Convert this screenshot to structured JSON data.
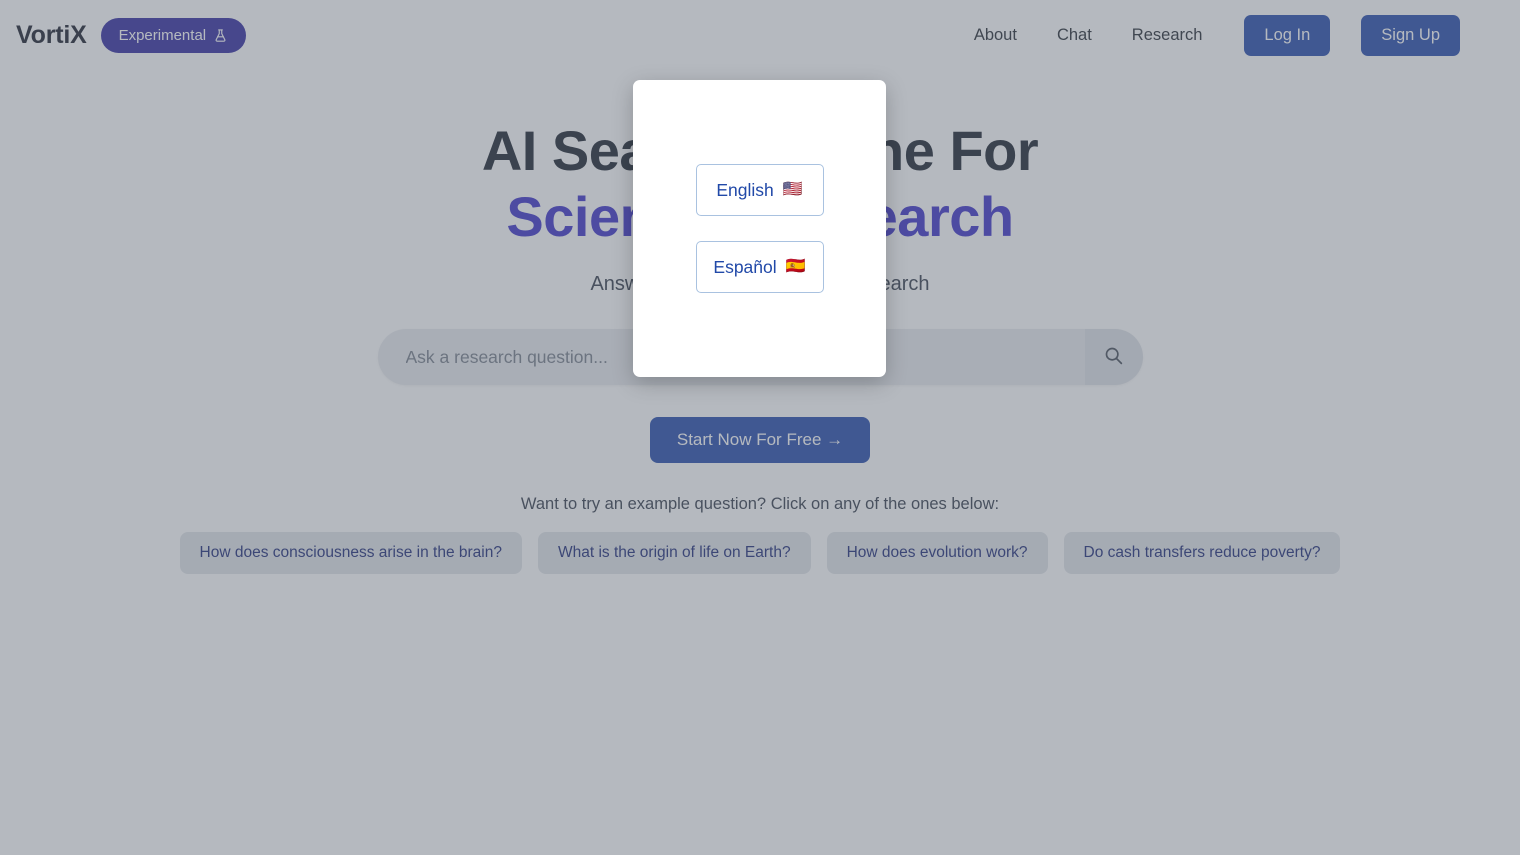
{
  "header": {
    "brand": "VortiX",
    "experimental_badge": "Experimental",
    "flask_icon": "flask-icon",
    "nav": [
      {
        "label": "About"
      },
      {
        "label": "Chat"
      },
      {
        "label": "Research"
      }
    ],
    "login_label": "Log In",
    "signup_label": "Sign Up"
  },
  "hero": {
    "title_line1": "AI Search Engine For",
    "title_line2": "Scientific Research",
    "subtitle": "Answers backed by scientific research"
  },
  "search": {
    "placeholder": "Ask a research question...",
    "value": "",
    "icon": "search-icon"
  },
  "cta": {
    "label": "Start Now For Free →"
  },
  "examples": {
    "label": "Want to try an example question? Click on any of the ones below:",
    "chips": [
      {
        "label": "How does consciousness arise in the brain?"
      },
      {
        "label": "What is the origin of life on Earth?"
      },
      {
        "label": "How does evolution work?"
      },
      {
        "label": "Do cash transfers reduce poverty?"
      }
    ]
  },
  "language_modal": {
    "options": [
      {
        "label": "English",
        "flag": "🇺🇸"
      },
      {
        "label": "Español",
        "flag": "🇪🇸"
      }
    ]
  },
  "colors": {
    "accent": "#4338ca",
    "primary_button": "#2a4fae",
    "badge": "#3730a3",
    "chip_text": "#24307a",
    "lang_text": "#2149a8"
  }
}
